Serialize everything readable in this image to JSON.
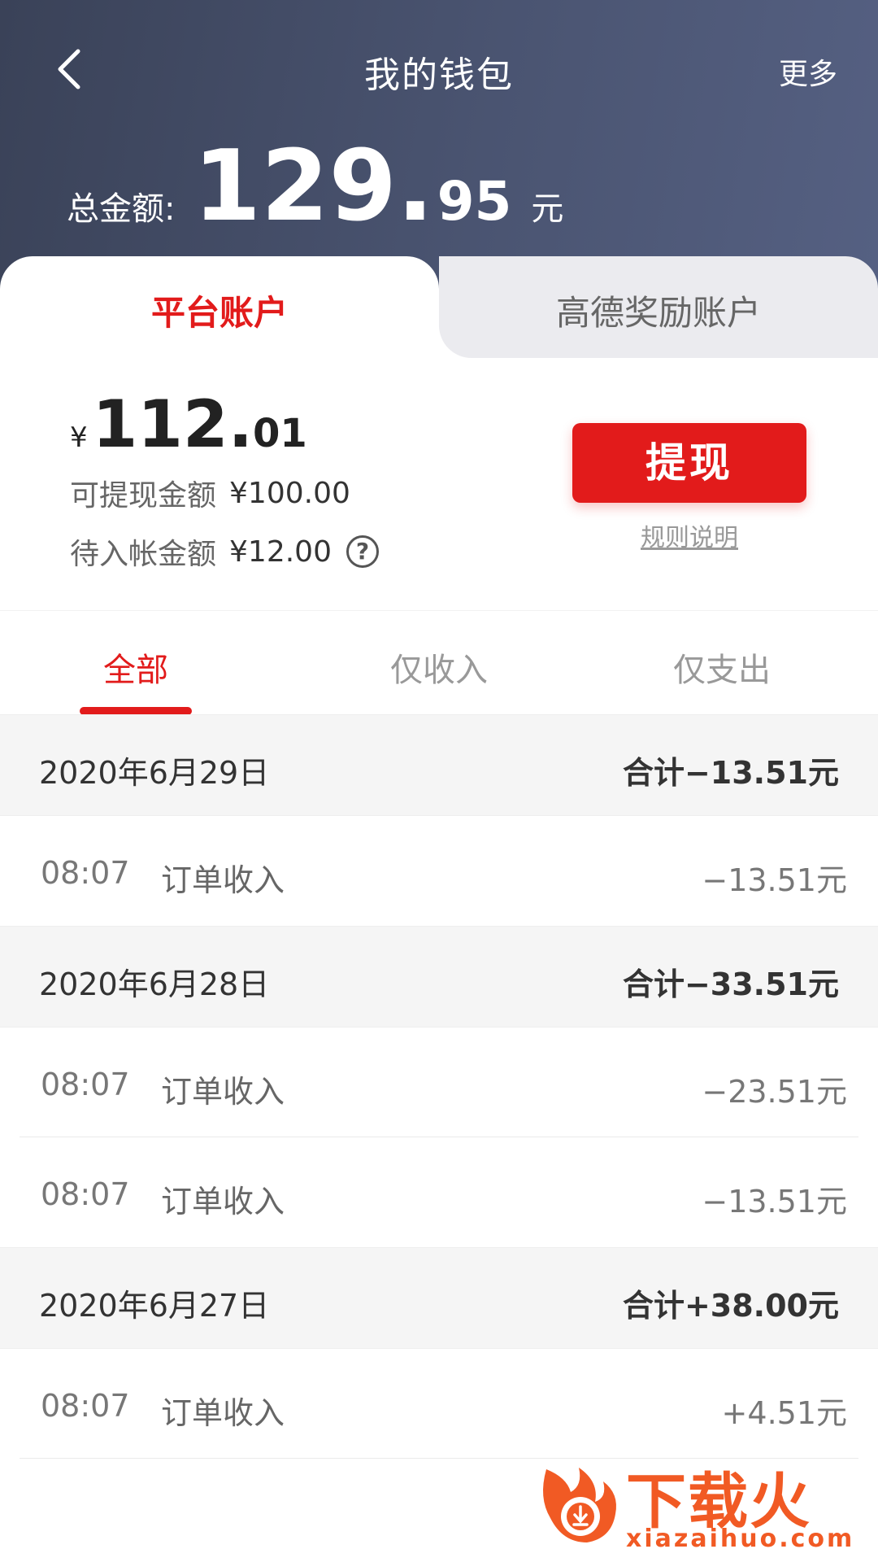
{
  "header": {
    "title": "我的钱包",
    "more_label": "更多",
    "total_label": "总金额:",
    "total_int": "129.",
    "total_dec": "95",
    "total_unit": "元"
  },
  "account_tabs": [
    {
      "label": "平台账户",
      "active": true
    },
    {
      "label": "高德奖励账户",
      "active": false
    }
  ],
  "balance": {
    "currency": "¥",
    "amount_int": "112.",
    "amount_dec": "01",
    "withdrawable_label": "可提现金额",
    "withdrawable_value": "¥100.00",
    "pending_label": "待入帐金额",
    "pending_value": "¥12.00",
    "withdraw_button": "提现",
    "rules_link": "规则说明"
  },
  "filter_tabs": [
    {
      "label": "全部",
      "active": true
    },
    {
      "label": "仅收入",
      "active": false
    },
    {
      "label": "仅支出",
      "active": false
    }
  ],
  "days": [
    {
      "date": "2020年6月29日",
      "total": "合计−13.51元",
      "items": [
        {
          "time": "08:07",
          "desc": "订单收入",
          "amount": "−13.51元"
        }
      ]
    },
    {
      "date": "2020年6月28日",
      "total": "合计−33.51元",
      "items": [
        {
          "time": "08:07",
          "desc": "订单收入",
          "amount": "−23.51元"
        },
        {
          "time": "08:07",
          "desc": "订单收入",
          "amount": "−13.51元"
        }
      ]
    },
    {
      "date": "2020年6月27日",
      "total": "合计+38.00元",
      "items": [
        {
          "time": "08:07",
          "desc": "订单收入",
          "amount": "+4.51元"
        }
      ]
    }
  ],
  "watermark": {
    "text": "下载火",
    "url": "xiazaihuo.com"
  },
  "colors": {
    "accent": "#e21b1b",
    "header_start": "#3a4258",
    "header_end": "#556082",
    "watermark": "#f15a24"
  }
}
